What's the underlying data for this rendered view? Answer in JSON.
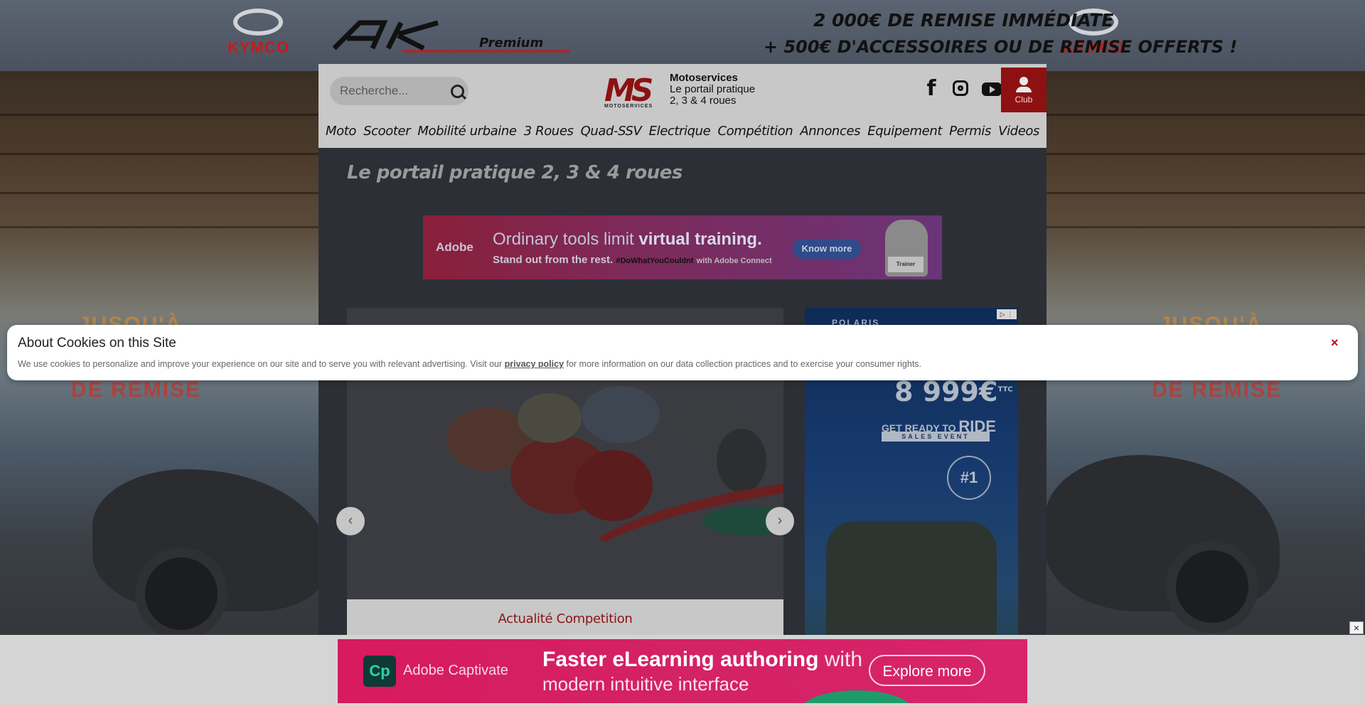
{
  "skin": {
    "left_brand": "KYMCO",
    "right_brand": "KYMCO",
    "center_logo": "AK Premium",
    "promo_line1": "2 000€ DE REMISE IMMÉDIATE",
    "promo_line2": "+ 500€ D'ACCESSOIRES OU DE REMISE OFFERTS !",
    "side_left_1": "JUSQU'À",
    "side_left_2": "DE  REMISE",
    "side_right_1": "JUSQU'À",
    "side_right_2": "DE  REMISE"
  },
  "header": {
    "search_placeholder": "Recherche...",
    "logo_text": "MS",
    "logo_sub": "MOTOSERVICES",
    "site_name": "Motoservices",
    "site_sub1": "Le portail pratique",
    "site_sub2": "2, 3 & 4 roues",
    "club_label": "Club",
    "social": [
      "facebook-icon",
      "instagram-icon",
      "youtube-icon"
    ]
  },
  "nav": [
    "Moto",
    "Scooter",
    "Mobilité urbaine",
    "3 Roues",
    "Quad-SSV",
    "Electrique",
    "Compétition",
    "Annonces",
    "Equipement",
    "Permis",
    "Videos"
  ],
  "tagline": "Le portail pratique 2, 3 & 4 roues",
  "ad_top": {
    "brand": "Adobe",
    "line1_a": "Ordinary tools limit ",
    "line1_b": "virtual training.",
    "line2": "Stand out from the rest.",
    "hashtag": "#DoWhatYouCouldnt",
    "hashtag_tail": "with Adobe Connect",
    "cta": "Know more",
    "trainer": "Trainer"
  },
  "slider": {
    "prev": "‹",
    "next": "›",
    "category": "Actualité Competition"
  },
  "ad_side": {
    "brand": "POLARIS",
    "price": "8 999€",
    "price_suffix": "TTC",
    "ready_a": "GET READY TO ",
    "ready_b": "RIDE",
    "sales": "SALES EVENT",
    "badge": "#1"
  },
  "cookie": {
    "title": "About Cookies on this Site",
    "msg_before": "We use cookies to personalize and improve your experience on our site and to serve you with relevant advertising. Visit our ",
    "link": "privacy policy",
    "msg_after": " for more information on our data collection practices and to exercise your consumer rights.",
    "close": "×"
  },
  "bottom_ad": {
    "logo": "Cp",
    "brand": "Adobe Captivate",
    "line1_b": "Faster eLearning authoring",
    "line1_a": " with",
    "line2": "modern intuitive interface",
    "cta": "Explore more",
    "close": "×"
  }
}
